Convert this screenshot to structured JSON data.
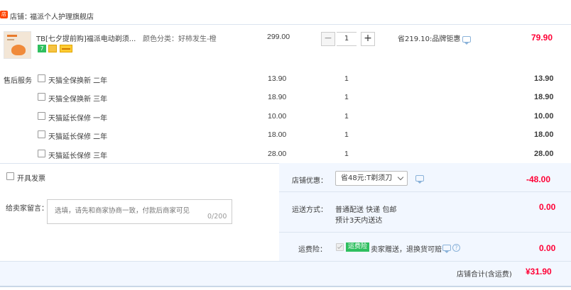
{
  "shop": {
    "label": "店铺：",
    "name": "福派个人护理旗舰店",
    "icon": "shop-icon"
  },
  "product": {
    "title": "TB[七夕提前购]福派电动剃须...",
    "variant": "颜色分类：好柿发生-橙",
    "unit_price": "299.00",
    "quantity": "1",
    "minus_label": "−",
    "plus_label": "+",
    "promo": "省219.10:品牌钜惠",
    "subtotal": "79.90"
  },
  "after_sales": {
    "label": "售后服务",
    "options": [
      {
        "name": "天猫全保换新 二年",
        "price": "13.90",
        "qty": "1",
        "total": "13.90"
      },
      {
        "name": "天猫全保换新 三年",
        "price": "18.90",
        "qty": "1",
        "total": "18.90"
      },
      {
        "name": "天猫延长保修 一年",
        "price": "10.00",
        "qty": "1",
        "total": "10.00"
      },
      {
        "name": "天猫延长保修 二年",
        "price": "18.00",
        "qty": "1",
        "total": "18.00"
      },
      {
        "name": "天猫延长保修 三年",
        "price": "28.00",
        "qty": "1",
        "total": "28.00"
      }
    ]
  },
  "invoice": {
    "label": "开具发票"
  },
  "message": {
    "label": "给卖家留言：",
    "placeholder": "选填，请先和商家协商一致，付款后商家可见",
    "counter": "0/200"
  },
  "discount": {
    "label": "店铺优惠：",
    "selected": "省48元:T剃须刀",
    "amount": "-48.00"
  },
  "shipping": {
    "label": "运送方式：",
    "method": "普通配送 快递 包邮",
    "eta": "预计3天内送达",
    "amount": "0.00"
  },
  "insurance": {
    "label": "运费险：",
    "badge": "运费险",
    "desc": "卖家赠送，退换货可赔",
    "amount": "0.00"
  },
  "total": {
    "label": "店铺合计(含运费)",
    "amount": "¥31.90"
  },
  "colors": {
    "accent_red": "#ff0036",
    "panel_bg": "#f2f7ff",
    "insurance_green": "#2fbf5f"
  }
}
